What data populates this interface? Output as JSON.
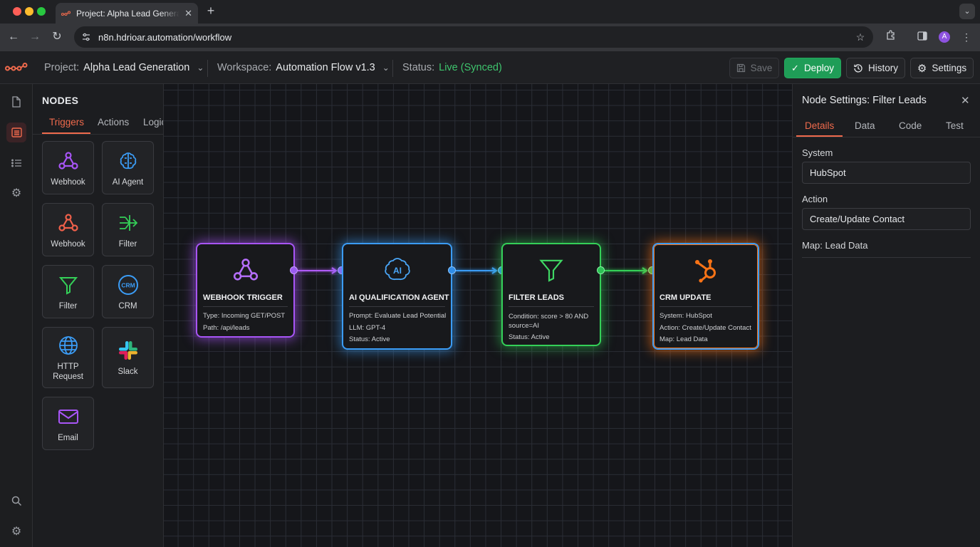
{
  "browser": {
    "tab_title": "Project: Alpha Lead Generation",
    "url": "n8n.hdrioar.automation/workflow",
    "profile_initial": "A"
  },
  "header": {
    "project_label": "Project:",
    "project_value": "Alpha Lead Generation",
    "workspace_label": "Workspace:",
    "workspace_value": "Automation Flow v1.3",
    "status_label": "Status:",
    "status_value": "Live (Synced)",
    "save_label": "Save",
    "deploy_label": "Deploy",
    "history_label": "History",
    "settings_label": "Settings"
  },
  "node_panel": {
    "title": "NODES",
    "tabs": [
      "Triggers",
      "Actions",
      "Logic"
    ],
    "active_tab": "Triggers",
    "items": [
      {
        "label": "Webhook",
        "icon": "webhook-icon",
        "color": "#a855f7"
      },
      {
        "label": "AI Agent",
        "icon": "ai-brain-icon",
        "color": "#3b9cf5"
      },
      {
        "label": "Webhook",
        "icon": "webhook-icon",
        "color": "#f0604a"
      },
      {
        "label": "Filter",
        "icon": "filter-flow-icon",
        "color": "#34d058"
      },
      {
        "label": "Filter",
        "icon": "filter-icon",
        "color": "#34d058"
      },
      {
        "label": "CRM",
        "icon": "crm-icon",
        "color": "#3b9cf5"
      },
      {
        "label": "HTTP Request",
        "icon": "globe-icon",
        "color": "#3b9cf5"
      },
      {
        "label": "Slack",
        "icon": "slack-icon",
        "color": "#e01e5a"
      },
      {
        "label": "Email",
        "icon": "email-icon",
        "color": "#a855f7"
      }
    ]
  },
  "workflow": {
    "nodes": [
      {
        "title": "WEBHOOK TRIGGER",
        "lines": [
          "Type: Incoming GET/POST",
          "Path: /api/leads"
        ],
        "color": "#a855f7",
        "icon": "webhook-icon"
      },
      {
        "title": "AI QUALIFICATION AGENT",
        "lines": [
          "Prompt: Evaluate Lead Potential",
          "LLM: GPT-4",
          "Status: Active"
        ],
        "color": "#3b9cf5",
        "icon": "ai-brain-icon"
      },
      {
        "title": "FILTER LEADS",
        "lines": [
          "Condition: score > 80 AND",
          "source=AI",
          "Status: Active"
        ],
        "color": "#34d058",
        "icon": "filter-icon"
      },
      {
        "title": "CRM UPDATE",
        "lines": [
          "System: HubSpot",
          "Action: Create/Update Contact",
          "Map: Lead Data"
        ],
        "color": "#f97316",
        "icon": "hubspot-icon"
      }
    ]
  },
  "node_settings": {
    "title": "Node Settings: Filter Leads",
    "tabs": [
      "Details",
      "Data",
      "Code",
      "Test"
    ],
    "active_tab": "Details",
    "system_label": "System",
    "system_value": "HubSpot",
    "action_label": "Action",
    "action_value": "Create/Update Contact",
    "map_label": "Map: Lead Data"
  }
}
